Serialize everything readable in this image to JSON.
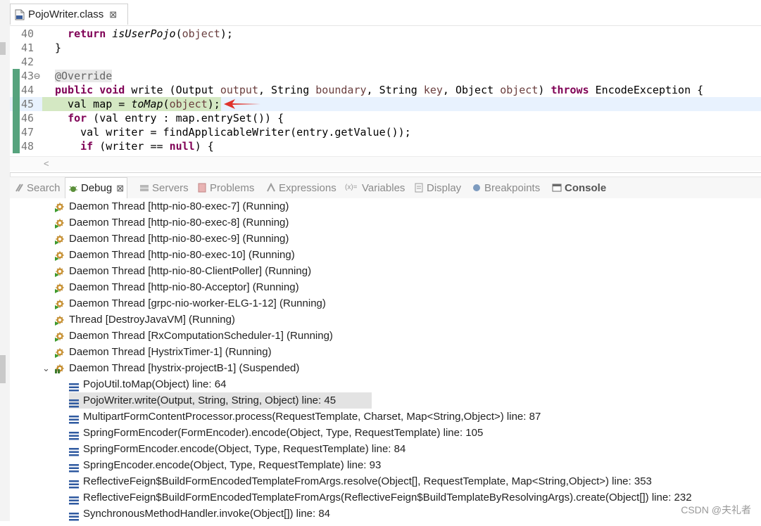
{
  "editor": {
    "tab_title": "PojoWriter.class",
    "close_glyph": "⊠",
    "lines": [
      {
        "num": "40",
        "html": "  <span class=\"kw\">return</span> <span class=\"it\">isUserPojo</span>(<span class=\"fld\">object</span>);"
      },
      {
        "num": "41",
        "html": "}"
      },
      {
        "num": "42",
        "html": ""
      },
      {
        "num": "43⊖",
        "html": "<span class=\"ann\">@Override</span>"
      },
      {
        "num": "44",
        "html": "<span class=\"kw\">public void</span> write (Output <span class=\"fld\">output</span>, String <span class=\"fld\">boundary</span>, String <span class=\"fld\">key</span>, Object <span class=\"fld\">object</span>) <span class=\"kw\">throws</span> EncodeException {"
      },
      {
        "num": "45",
        "html": "  val map = <span class=\"it\">toMap</span>(<span class=\"fld\">object</span>);"
      },
      {
        "num": "46",
        "html": "  <span class=\"kw\">for</span> (val entry : map.entrySet()) {"
      },
      {
        "num": "47",
        "html": "    val writer = findApplicableWriter(entry.getValue());"
      },
      {
        "num": "48",
        "html": "    <span class=\"kw\">if</span> (writer == <span class=\"kw\">null</span>) {"
      }
    ]
  },
  "views": {
    "search": "Search",
    "debug": "Debug",
    "debug_close": "⊠",
    "servers": "Servers",
    "problems": "Problems",
    "expressions": "Expressions",
    "variables": "Variables",
    "display": "Display",
    "breakpoints": "Breakpoints",
    "console": "Console"
  },
  "threads": [
    "Daemon Thread [http-nio-80-exec-7] (Running)",
    "Daemon Thread [http-nio-80-exec-8] (Running)",
    "Daemon Thread [http-nio-80-exec-9] (Running)",
    "Daemon Thread [http-nio-80-exec-10] (Running)",
    "Daemon Thread [http-nio-80-ClientPoller] (Running)",
    "Daemon Thread [http-nio-80-Acceptor] (Running)",
    "Daemon Thread [grpc-nio-worker-ELG-1-12] (Running)",
    "Thread [DestroyJavaVM] (Running)",
    "Daemon Thread [RxComputationScheduler-1] (Running)",
    "Daemon Thread [HystrixTimer-1] (Running)",
    "Daemon Thread [hystrix-projectB-1] (Suspended)"
  ],
  "frames": [
    "PojoUtil.toMap(Object) line: 64",
    "PojoWriter.write(Output, String, String, Object) line: 45",
    "MultipartFormContentProcessor.process(RequestTemplate, Charset, Map<String,Object>) line: 87",
    "SpringFormEncoder(FormEncoder).encode(Object, Type, RequestTemplate) line: 105",
    "SpringFormEncoder.encode(Object, Type, RequestTemplate) line: 84",
    "SpringEncoder.encode(Object, Type, RequestTemplate) line: 93",
    "ReflectiveFeign$BuildFormEncodedTemplateFromArgs.resolve(Object[], RequestTemplate, Map<String,Object>) line: 353",
    "ReflectiveFeign$BuildFormEncodedTemplateFromArgs(ReflectiveFeign$BuildTemplateByResolvingArgs).create(Object[]) line: 232",
    "SynchronousMethodHandler.invoke(Object[]) line: 84"
  ],
  "watermark": "CSDN @夫礼者",
  "colors": {
    "keyword": "#7f0055",
    "field": "#6a3e3e",
    "current_line": "#e8f2fe",
    "arrow": "#e0332b"
  }
}
